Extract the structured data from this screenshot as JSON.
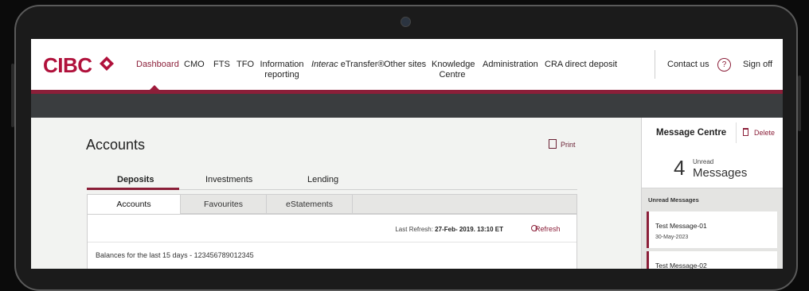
{
  "brand": {
    "logo_text": "CIBC",
    "accent_color": "#8b1f39",
    "logo_color": "#b0113b"
  },
  "nav": {
    "items": [
      {
        "label": "Dashboard",
        "active": true
      },
      {
        "label": "CMO"
      },
      {
        "label": "FTS"
      },
      {
        "label": "TFO"
      },
      {
        "label": "Information reporting"
      },
      {
        "label_em": "Interac",
        "label": "eTransfer®"
      },
      {
        "label": "Other sites"
      },
      {
        "label": "Knowledge Centre"
      },
      {
        "label": "Administration"
      },
      {
        "label": "CRA direct deposit"
      }
    ],
    "contact": "Contact us",
    "help_icon": "?",
    "signoff": "Sign off"
  },
  "page": {
    "title": "Accounts",
    "print_label": "Print",
    "tabs": [
      "Deposits",
      "Investments",
      "Lending"
    ],
    "subtabs": [
      "Accounts",
      "Favourites",
      "eStatements"
    ],
    "last_refresh_label": "Last Refresh:",
    "last_refresh_value": "27-Feb- 2019. 13:10 ET",
    "refresh_label": "Refresh",
    "balances_text": "Balances for the last 15 days - 123456789012345"
  },
  "messages": {
    "title": "Message Centre",
    "delete_label": "Delete",
    "unread_count": "4",
    "unread_small": "Unread",
    "unread_big": "Messages",
    "unread_heading": "Unread Messages",
    "items": [
      {
        "title": "Test Message-01",
        "date": "30-May-2023"
      },
      {
        "title": "Test Message-02",
        "date": ""
      }
    ]
  }
}
